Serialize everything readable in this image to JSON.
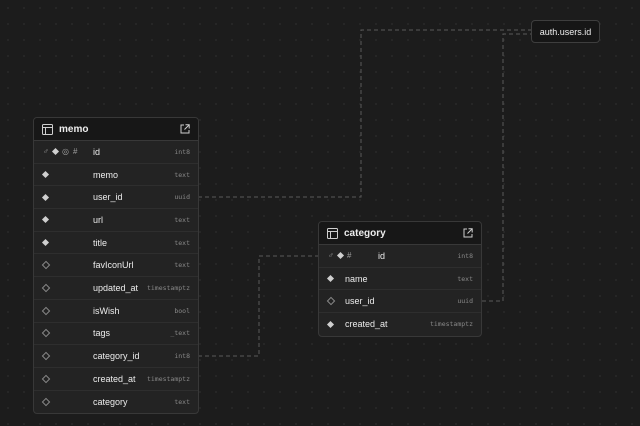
{
  "ref_node": {
    "label": "auth.users.id"
  },
  "tables": [
    {
      "name": "memo",
      "columns": [
        {
          "name": "id",
          "type": "int8",
          "markers": [
            "key",
            "filled",
            "identity",
            "hash"
          ]
        },
        {
          "name": "memo",
          "type": "text",
          "markers": [
            "filled"
          ]
        },
        {
          "name": "user_id",
          "type": "uuid",
          "markers": [
            "filled"
          ]
        },
        {
          "name": "url",
          "type": "text",
          "markers": [
            "filled"
          ]
        },
        {
          "name": "title",
          "type": "text",
          "markers": [
            "filled"
          ]
        },
        {
          "name": "favIconUrl",
          "type": "text",
          "markers": [
            "hollow"
          ]
        },
        {
          "name": "updated_at",
          "type": "timestamptz",
          "markers": [
            "hollow"
          ]
        },
        {
          "name": "isWish",
          "type": "bool",
          "markers": [
            "hollow"
          ]
        },
        {
          "name": "tags",
          "type": "_text",
          "markers": [
            "hollow"
          ]
        },
        {
          "name": "category_id",
          "type": "int8",
          "markers": [
            "hollow"
          ]
        },
        {
          "name": "created_at",
          "type": "timestamptz",
          "markers": [
            "hollow"
          ]
        },
        {
          "name": "category",
          "type": "text",
          "markers": [
            "hollow"
          ]
        }
      ]
    },
    {
      "name": "category",
      "columns": [
        {
          "name": "id",
          "type": "int8",
          "markers": [
            "key",
            "filled",
            "hash"
          ]
        },
        {
          "name": "name",
          "type": "text",
          "markers": [
            "filled"
          ]
        },
        {
          "name": "user_id",
          "type": "uuid",
          "markers": [
            "hollow"
          ]
        },
        {
          "name": "created_at",
          "type": "timestamptz",
          "markers": [
            "filled"
          ]
        }
      ]
    }
  ],
  "icons": {
    "table": "table-icon",
    "open": "external-link-icon"
  },
  "colors": {
    "edge": "#5a5a5a",
    "background": "#1c1c1c",
    "header": "#171717"
  }
}
